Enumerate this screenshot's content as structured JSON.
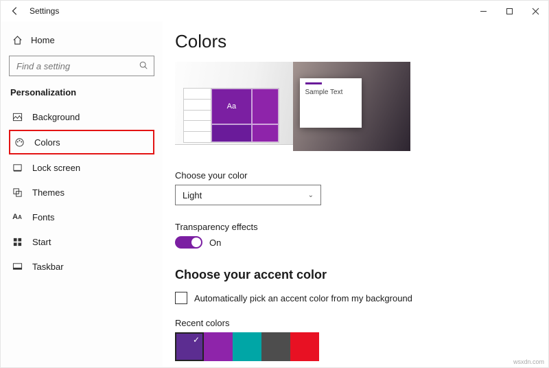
{
  "app_title": "Settings",
  "home_label": "Home",
  "search_placeholder": "Find a setting",
  "section_title": "Personalization",
  "nav": [
    {
      "label": "Background"
    },
    {
      "label": "Colors"
    },
    {
      "label": "Lock screen"
    },
    {
      "label": "Themes"
    },
    {
      "label": "Fonts"
    },
    {
      "label": "Start"
    },
    {
      "label": "Taskbar"
    }
  ],
  "page_title": "Colors",
  "preview_tile_text": "Aa",
  "sample_text": "Sample Text",
  "choose_color_label": "Choose your color",
  "choose_color_value": "Light",
  "transparency_label": "Transparency effects",
  "transparency_state": "On",
  "accent_heading": "Choose your accent color",
  "auto_pick_label": "Automatically pick an accent color from my background",
  "recent_label": "Recent colors",
  "recent_colors": [
    "#5c2d91",
    "#8e24aa",
    "#00a6a6",
    "#4d4d4d",
    "#e81123"
  ],
  "watermark": "wsxdn.com"
}
